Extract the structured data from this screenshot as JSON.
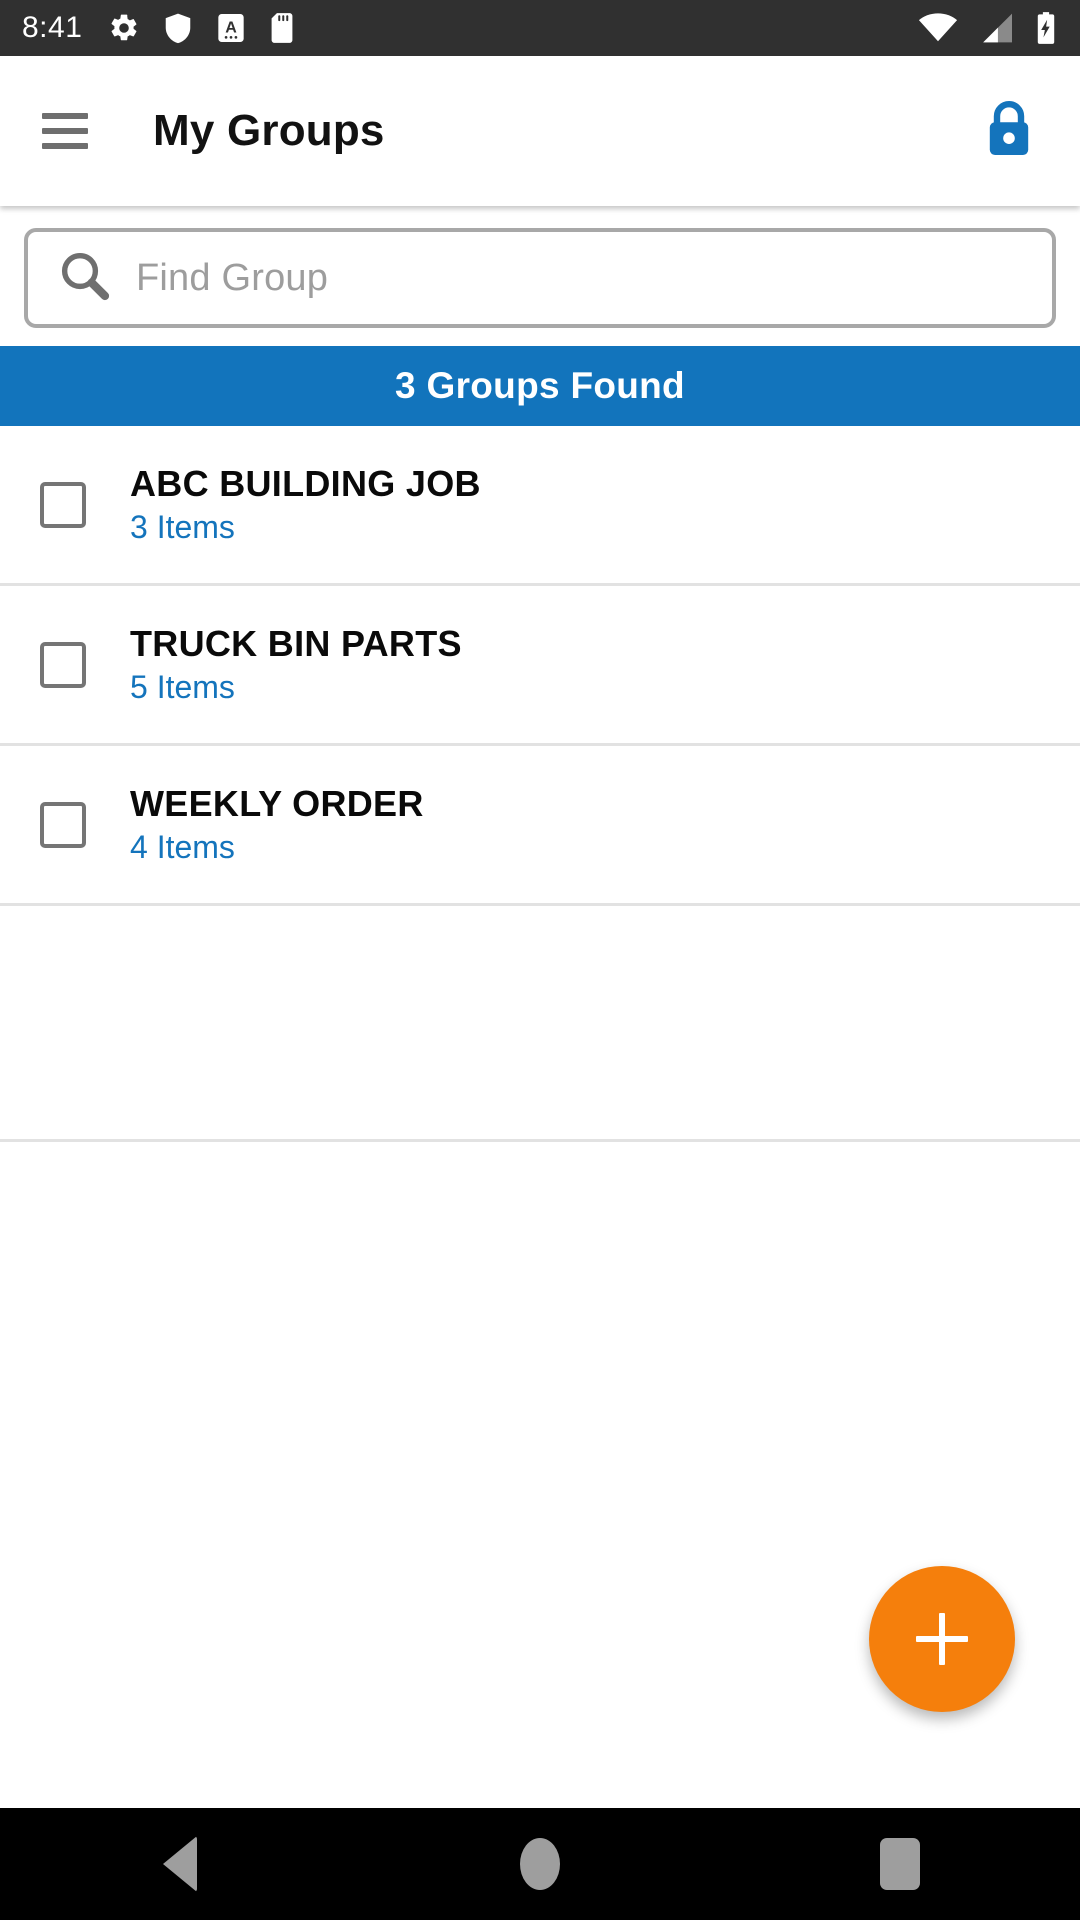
{
  "status_bar": {
    "time": "8:41",
    "left_icons": [
      "gear-icon",
      "shield-icon",
      "a-badge-icon",
      "sd-card-icon"
    ],
    "right_icons": [
      "wifi-icon",
      "cell-signal-icon",
      "battery-charging-icon"
    ],
    "background_color": "#303030"
  },
  "app_bar": {
    "menu_icon": "hamburger-menu-icon",
    "title": "My Groups",
    "action_icon": "lock-icon",
    "lock_color": "#1474bc"
  },
  "search": {
    "icon": "search-icon",
    "value": "",
    "placeholder": "Find Group"
  },
  "banner": {
    "text": "3 Groups Found",
    "background_color": "#1274bc",
    "text_color": "#ffffff"
  },
  "groups": [
    {
      "name": "ABC BUILDING JOB",
      "items": "3 Items",
      "checked": false
    },
    {
      "name": "TRUCK BIN PARTS",
      "items": "5 Items",
      "checked": false
    },
    {
      "name": "WEEKLY ORDER",
      "items": "4 Items",
      "checked": false
    }
  ],
  "fab": {
    "icon": "plus-icon",
    "color": "#f57f0c"
  },
  "nav_bar": {
    "back": "back-triangle-icon",
    "home": "home-circle-icon",
    "recents": "recents-square-icon",
    "background_color": "#000000"
  }
}
